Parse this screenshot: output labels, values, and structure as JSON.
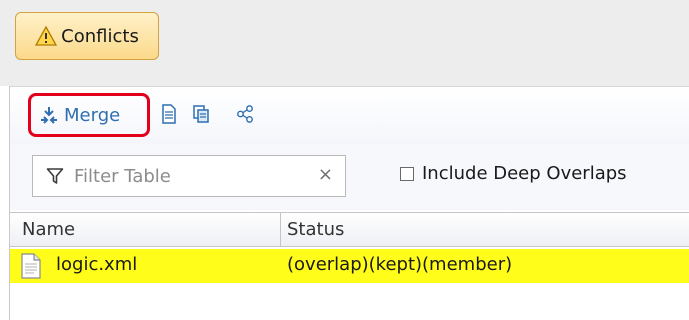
{
  "top": {
    "conflicts_label": "Conflicts"
  },
  "toolbar": {
    "merge_label": "Merge"
  },
  "filter": {
    "placeholder": "Filter Table",
    "clear_glyph": "×"
  },
  "deep_overlaps": {
    "label": "Include Deep Overlaps",
    "checked": false
  },
  "table": {
    "columns": [
      "Name",
      "Status"
    ],
    "rows": [
      {
        "name": "logic.xml",
        "status": "(overlap)(kept)(member)"
      }
    ]
  },
  "colors": {
    "conflict_button": "#fbd98a",
    "merge_highlight": "#e3001b",
    "selected_row": "#fffd19",
    "accent_blue": "#2f6fb1"
  },
  "icons": [
    "warning-icon",
    "merge-icon",
    "document-icon",
    "copy-icon",
    "share-icon",
    "filter-icon",
    "file-icon"
  ]
}
